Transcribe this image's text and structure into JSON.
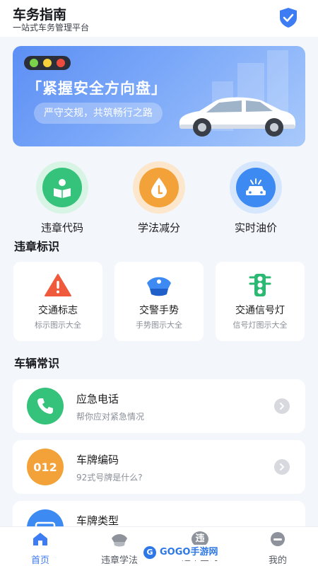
{
  "header": {
    "title": "车务指南",
    "subtitle": "一站式车务管理平台"
  },
  "banner": {
    "title": "「紧握安全方向盘」",
    "slogan": "严守交规，共筑畅行之路"
  },
  "quick_actions": [
    {
      "label": "违章代码",
      "icon": "reader-icon",
      "color": "#35c27a"
    },
    {
      "label": "学法减分",
      "icon": "water-drop-icon",
      "color": "#f3a23a"
    },
    {
      "label": "实时油价",
      "icon": "car-icon",
      "color": "#3d8af2"
    }
  ],
  "sections": {
    "signs_title": "违章标识",
    "knowledge_title": "车辆常识"
  },
  "sign_cards": [
    {
      "title": "交通标志",
      "subtitle": "标示图示大全",
      "icon": "warning-triangle-icon"
    },
    {
      "title": "交警手势",
      "subtitle": "手势图示大全",
      "icon": "police-cap-icon"
    },
    {
      "title": "交通信号灯",
      "subtitle": "信号灯图示大全",
      "icon": "traffic-light-icon"
    }
  ],
  "knowledge_cards": [
    {
      "title": "应急电话",
      "subtitle": "帮你应对紧急情况",
      "icon": "phone-icon",
      "color": "#35c27a"
    },
    {
      "title": "车牌编码",
      "subtitle": "92式号牌是什么?",
      "icon_text": "012",
      "color": "#f3a23a"
    },
    {
      "title": "车牌类型",
      "subtitle": "",
      "icon": "plate-icon",
      "color": "#3d8af2"
    }
  ],
  "tabs": [
    {
      "label": "首页",
      "icon": "home-icon",
      "active": true
    },
    {
      "label": "违章学法",
      "icon": "police-cap-icon",
      "active": false
    },
    {
      "label": "违章查询",
      "icon_text": "违",
      "active": false
    },
    {
      "label": "我的",
      "icon": "user-icon",
      "active": false
    }
  ],
  "watermark": {
    "logo": "G",
    "text": "GOGO手游网"
  },
  "colors": {
    "accent": "#3d7cf2",
    "background": "#f3f6fb"
  }
}
